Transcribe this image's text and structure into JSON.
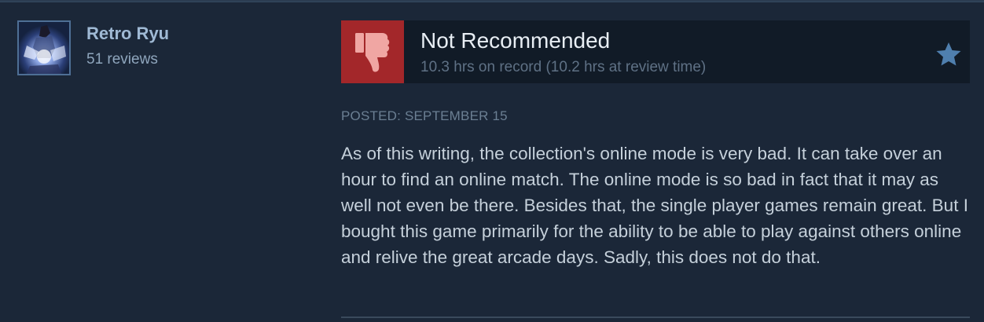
{
  "author": {
    "name": "Retro Ryu",
    "reviews": "51 reviews"
  },
  "verdict": {
    "title": "Not Recommended",
    "hours": "10.3 hrs on record (10.2 hrs at review time)",
    "icon": "thumbs-down-icon",
    "color": "#a3272a"
  },
  "review": {
    "posted": "POSTED: SEPTEMBER 15",
    "body": "As of this writing, the collection's online mode is very bad. It can take over an hour to find an online match. The online mode is so bad in fact that it may as well not even be there. Besides that, the single player games remain great. But I bought this game primarily for the ability to be able to play against others online and relive the great arcade days. Sadly, this does not do that."
  },
  "colors": {
    "background": "#1b2738",
    "accent_name": "#9fb9d4",
    "star": "#4f7fae"
  }
}
